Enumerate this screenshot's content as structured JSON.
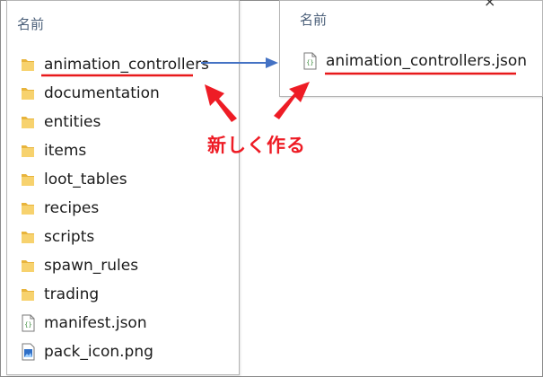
{
  "left_panel": {
    "column_header": "名前",
    "items": [
      {
        "name": "animation_controllers",
        "type": "folder"
      },
      {
        "name": "documentation",
        "type": "folder"
      },
      {
        "name": "entities",
        "type": "folder"
      },
      {
        "name": "items",
        "type": "folder"
      },
      {
        "name": "loot_tables",
        "type": "folder"
      },
      {
        "name": "recipes",
        "type": "folder"
      },
      {
        "name": "scripts",
        "type": "folder"
      },
      {
        "name": "spawn_rules",
        "type": "folder"
      },
      {
        "name": "trading",
        "type": "folder"
      },
      {
        "name": "manifest.json",
        "type": "json"
      },
      {
        "name": "pack_icon.png",
        "type": "png"
      }
    ]
  },
  "right_panel": {
    "column_header": "名前",
    "items": [
      {
        "name": "animation_controllers.json",
        "type": "json"
      }
    ]
  },
  "annotation": {
    "text": "新しく作る",
    "color": "#ee1c25"
  },
  "colors": {
    "folder": "#f2c94c",
    "arrow_blue": "#4472c4",
    "underline_red": "#e8191b"
  }
}
